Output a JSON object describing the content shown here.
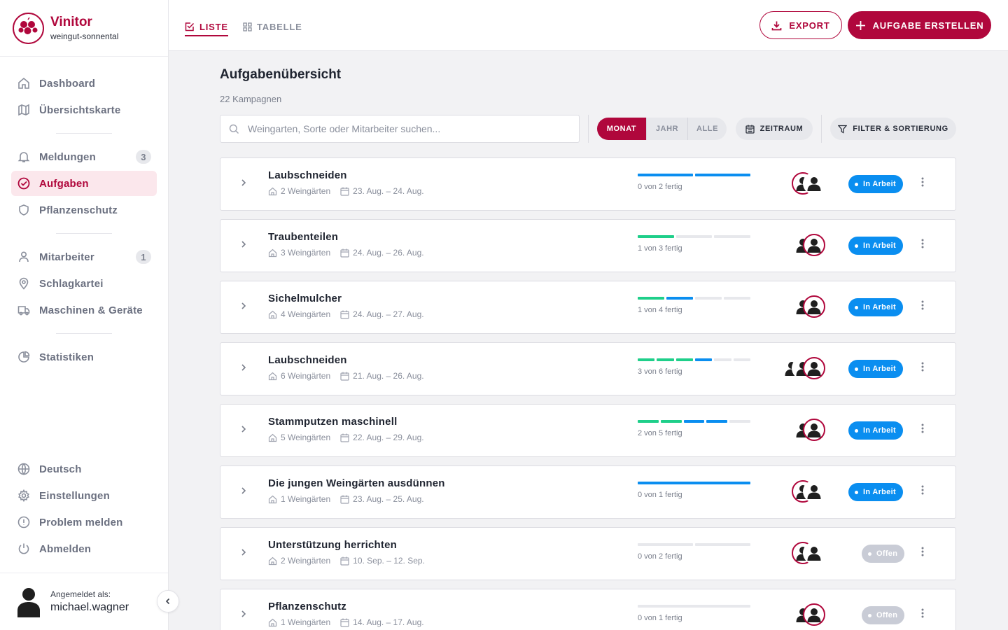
{
  "brand": {
    "name": "Vinitor",
    "subtitle": "weingut-sonnental"
  },
  "nav": {
    "dashboard": "Dashboard",
    "overview_map": "Übersichtskarte",
    "notifications": "Meldungen",
    "notifications_count": "3",
    "tasks": "Aufgaben",
    "plant_protection": "Pflanzenschutz",
    "employees": "Mitarbeiter",
    "employees_count": "1",
    "field_register": "Schlagkartei",
    "machines": "Maschinen & Geräte",
    "statistics": "Statistiken",
    "language": "Deutsch",
    "settings": "Einstellungen",
    "report_problem": "Problem melden",
    "logout": "Abmelden"
  },
  "user": {
    "label": "Angemeldet als:",
    "name": "michael.wagner"
  },
  "topbar": {
    "tab_list": "LISTE",
    "tab_table": "TABELLE",
    "export": "EXPORT",
    "create_task": "AUFGABE ERSTELLEN"
  },
  "main": {
    "title": "Aufgabenübersicht",
    "subtitle": "22 Kampagnen",
    "search_placeholder": "Weingarten, Sorte oder Mitarbeiter suchen...",
    "period_month": "MONAT",
    "period_year": "JAHR",
    "period_all": "ALLE",
    "time_range": "ZEITRAUM",
    "filter_sort": "FILTER & SORTIERUNG"
  },
  "colors": {
    "accent": "#b0073c",
    "done": "#1fcf8a",
    "in_progress": "#0a8ef0",
    "pending": "#e7e8ec",
    "open_badge": "#c9ccd6"
  },
  "tasks": [
    {
      "title": "Laubschneiden",
      "vineyards": "2 Weingärten",
      "dates": "23. Aug. – 24. Aug.",
      "progress": "0 von 2 fertig",
      "segments": [
        "progress",
        "progress"
      ],
      "status": "In Arbeit"
    },
    {
      "title": "Traubenteilen",
      "vineyards": "3 Weingärten",
      "dates": "24. Aug. – 26. Aug.",
      "progress": "1 von 3 fertig",
      "segments": [
        "done",
        "pending",
        "pending"
      ],
      "status": "In Arbeit"
    },
    {
      "title": "Sichelmulcher",
      "vineyards": "4 Weingärten",
      "dates": "24. Aug. – 27. Aug.",
      "progress": "1 von 4 fertig",
      "segments": [
        "done",
        "progress",
        "pending",
        "pending"
      ],
      "status": "In Arbeit"
    },
    {
      "title": "Laubschneiden",
      "vineyards": "6 Weingärten",
      "dates": "21. Aug. – 26. Aug.",
      "progress": "3 von 6 fertig",
      "segments": [
        "done",
        "done",
        "done",
        "progress",
        "pending",
        "pending"
      ],
      "status": "In Arbeit"
    },
    {
      "title": "Stammputzen maschinell",
      "vineyards": "5 Weingärten",
      "dates": "22. Aug. – 29. Aug.",
      "progress": "2 von 5 fertig",
      "segments": [
        "done",
        "done",
        "progress",
        "progress",
        "pending"
      ],
      "status": "In Arbeit"
    },
    {
      "title": "Die jungen Weingärten ausdünnen",
      "vineyards": "1 Weingärten",
      "dates": "23. Aug. – 25. Aug.",
      "progress": "0 von 1 fertig",
      "segments": [
        "progress"
      ],
      "status": "In Arbeit"
    },
    {
      "title": "Unterstützung herrichten",
      "vineyards": "2 Weingärten",
      "dates": "10. Sep. – 12. Sep.",
      "progress": "0 von 2 fertig",
      "segments": [
        "pending",
        "pending"
      ],
      "status": "Offen"
    },
    {
      "title": "Pflanzenschutz",
      "vineyards": "1 Weingärten",
      "dates": "14. Aug. – 17. Aug.",
      "progress": "0 von 1 fertig",
      "segments": [
        "pending"
      ],
      "status": "Offen"
    }
  ]
}
